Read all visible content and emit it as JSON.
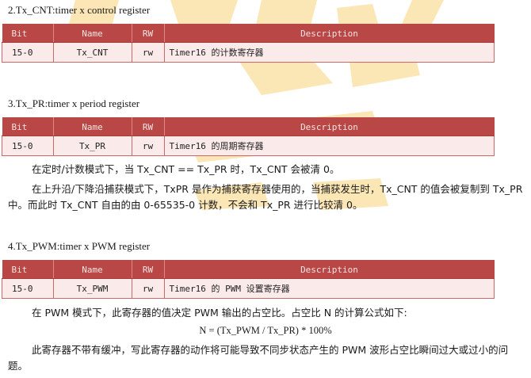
{
  "sections": [
    {
      "title": "2.Tx_CNT:timer x control register",
      "headers": {
        "bit": "Bit",
        "name": "Name",
        "rw": "RW",
        "desc": "Description"
      },
      "row": {
        "bit": "15-0",
        "name": "Tx_CNT",
        "rw": "rw",
        "desc": "Timer16 的计数寄存器"
      }
    },
    {
      "title": "3.Tx_PR:timer x period register",
      "headers": {
        "bit": "Bit",
        "name": "Name",
        "rw": "RW",
        "desc": "Description"
      },
      "row": {
        "bit": "15-0",
        "name": "Tx_PR",
        "rw": "rw",
        "desc": "Timer16 的周期寄存器"
      }
    },
    {
      "title": "4.Tx_PWM:timer x PWM register",
      "headers": {
        "bit": "Bit",
        "name": "Name",
        "rw": "RW",
        "desc": "Description"
      },
      "row": {
        "bit": "15-0",
        "name": "Tx_PWM",
        "rw": "rw",
        "desc": "Timer16 的 PWM 设置寄存器"
      }
    }
  ],
  "paragraphs": {
    "p1": "在定时/计数模式下，当 Tx_CNT == Tx_PR 时，Tx_CNT 会被清 0。",
    "p2": "在上升沿/下降沿捕获模式下，TxPR 是作为捕获寄存器使用的，当捕获发生时，Tx_CNT 的值会被复制到 Tx_PR 中。而此时 Tx_CNT 自由的由 0-65535-0 计数，不会和 Tx_PR 进行比较清 0。",
    "p3": "在 PWM 模式下，此寄存器的值决定 PWM 输出的占空比。占空比 N 的计算公式如下:",
    "formula": "N = (Tx_PWM / Tx_PR) * 100%",
    "p4": "此寄存器不带有缓冲，写此寄存器的动作将可能导致不同步状态产生的 PWM 波形占空比瞬间过大或过小的问题。"
  },
  "colors": {
    "header_bg": "#b94745",
    "row_bg": "#fbeaea",
    "watermark": "#f7c64a"
  }
}
